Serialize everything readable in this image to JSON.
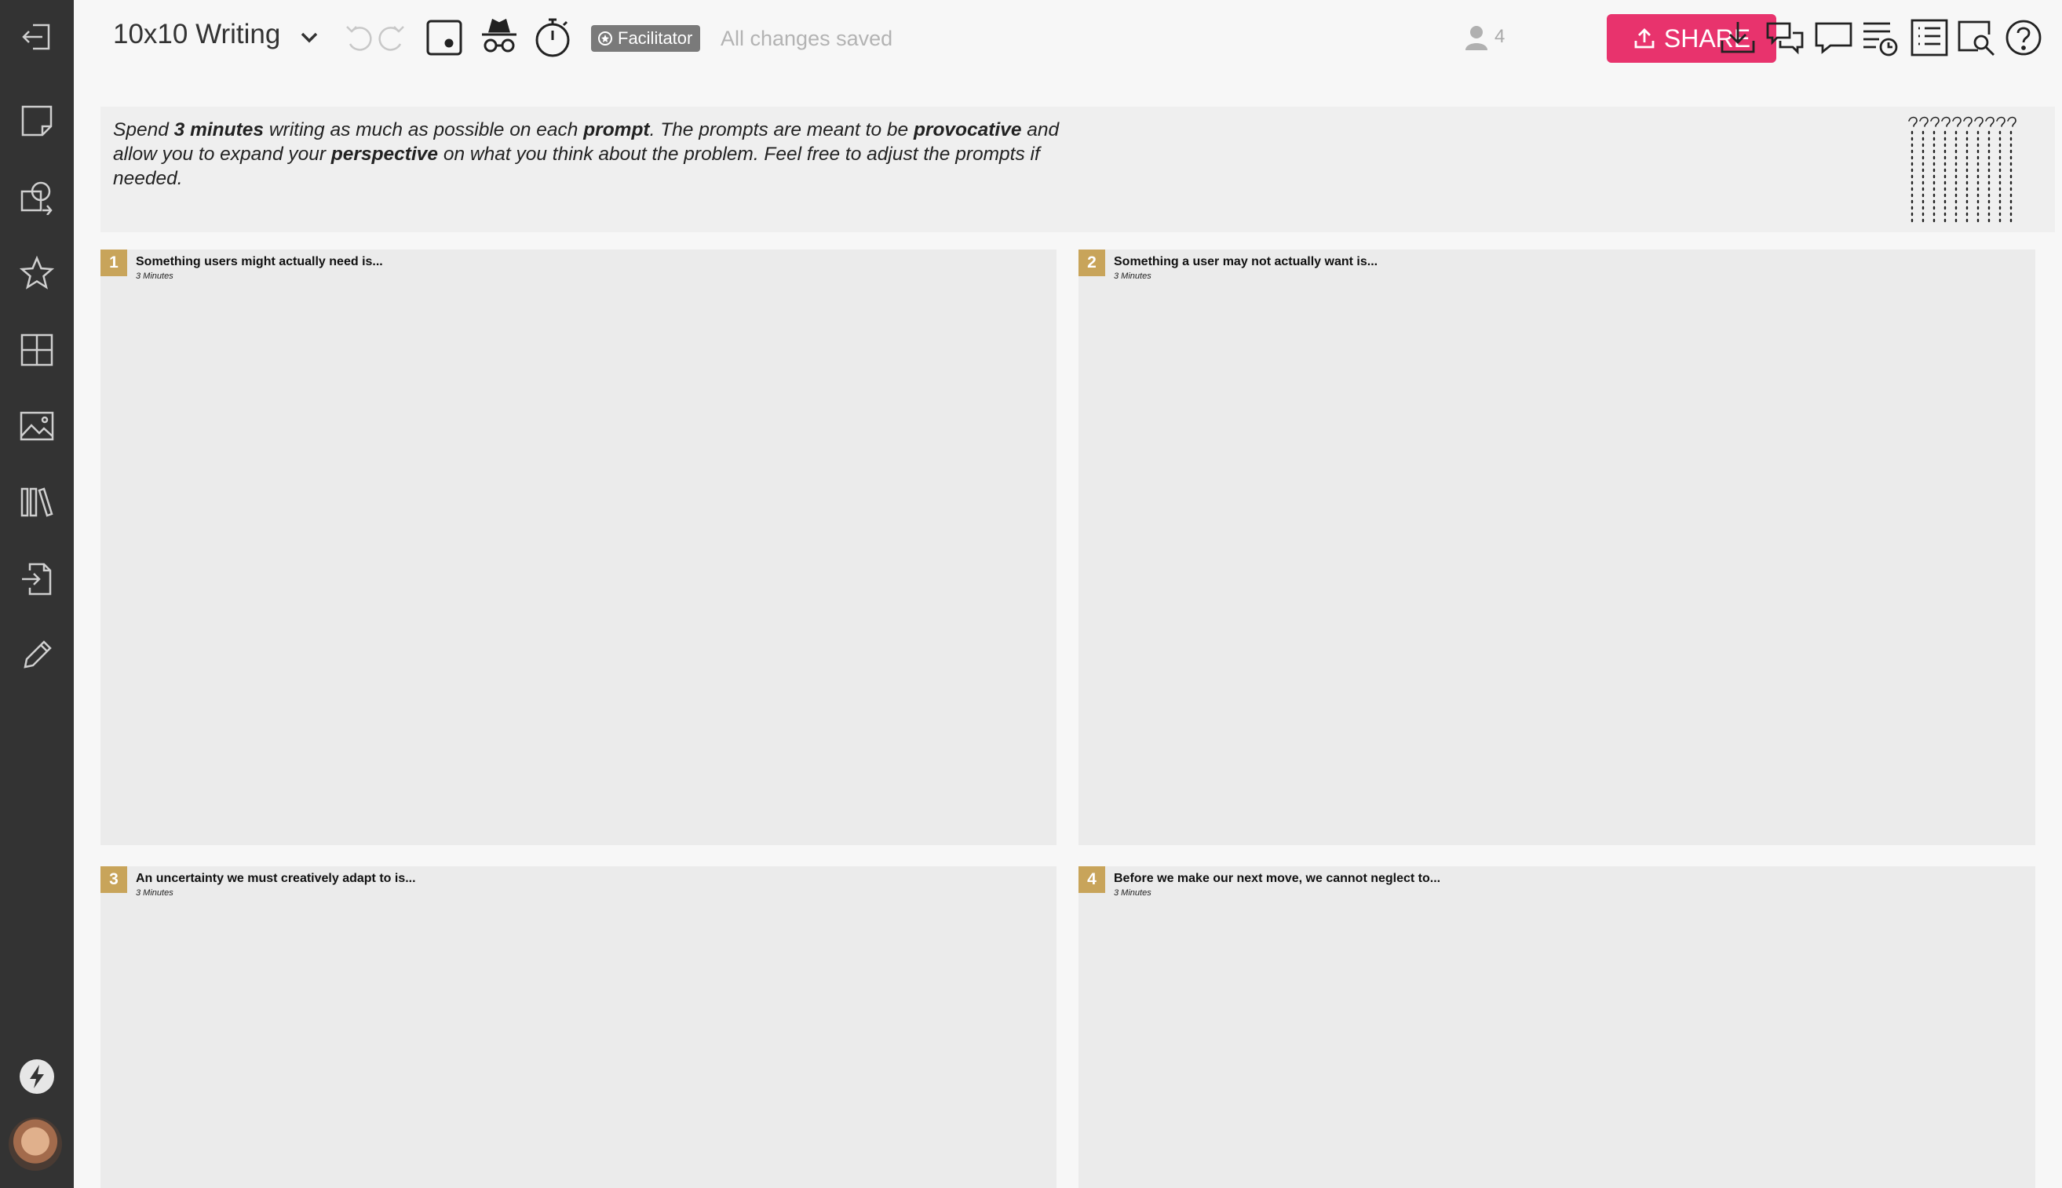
{
  "app": {
    "board_title": "10x10 Writing",
    "facilitator_label": "Facilitator",
    "save_status": "All changes saved",
    "user_count": "4",
    "share_label": "SHARE"
  },
  "sidebar": {
    "items": [
      {
        "name": "exit",
        "icon": "exit-icon"
      },
      {
        "name": "sticky-note",
        "icon": "sticky-note-icon"
      },
      {
        "name": "shapes",
        "icon": "shapes-icon"
      },
      {
        "name": "favorites",
        "icon": "star-icon"
      },
      {
        "name": "templates",
        "icon": "grid-icon"
      },
      {
        "name": "image",
        "icon": "image-icon"
      },
      {
        "name": "library",
        "icon": "library-icon"
      },
      {
        "name": "import",
        "icon": "import-icon"
      },
      {
        "name": "draw",
        "icon": "pencil-icon"
      }
    ]
  },
  "instructions": {
    "segments": [
      {
        "text": "Spend ",
        "bold": false
      },
      {
        "text": "3 minutes",
        "bold": true
      },
      {
        "text": " writing as much as possible on each ",
        "bold": false
      },
      {
        "text": "prompt",
        "bold": true
      },
      {
        "text": ". The prompts are meant to be ",
        "bold": false
      },
      {
        "text": "provocative",
        "bold": true
      },
      {
        "text": " and allow you to expand your ",
        "bold": false
      },
      {
        "text": "perspective",
        "bold": true
      },
      {
        "text": " on what you think about the problem. Feel free to adjust the prompts if needed.",
        "bold": false
      }
    ]
  },
  "panels": [
    {
      "num": "1",
      "title": "Something users might actually need is...",
      "duration": "3 Minutes"
    },
    {
      "num": "2",
      "title": "Something a user may not actually want is...",
      "duration": "3 Minutes"
    },
    {
      "num": "3",
      "title": "An uncertainty we must creatively adapt to is...",
      "duration": "3 Minutes"
    },
    {
      "num": "4",
      "title": "Before we make our next move, we cannot neglect to...",
      "duration": "3 Minutes"
    }
  ],
  "colors": {
    "share": "#e8336d",
    "panel_number": "#c8a45a",
    "sidebar": "#333333"
  }
}
